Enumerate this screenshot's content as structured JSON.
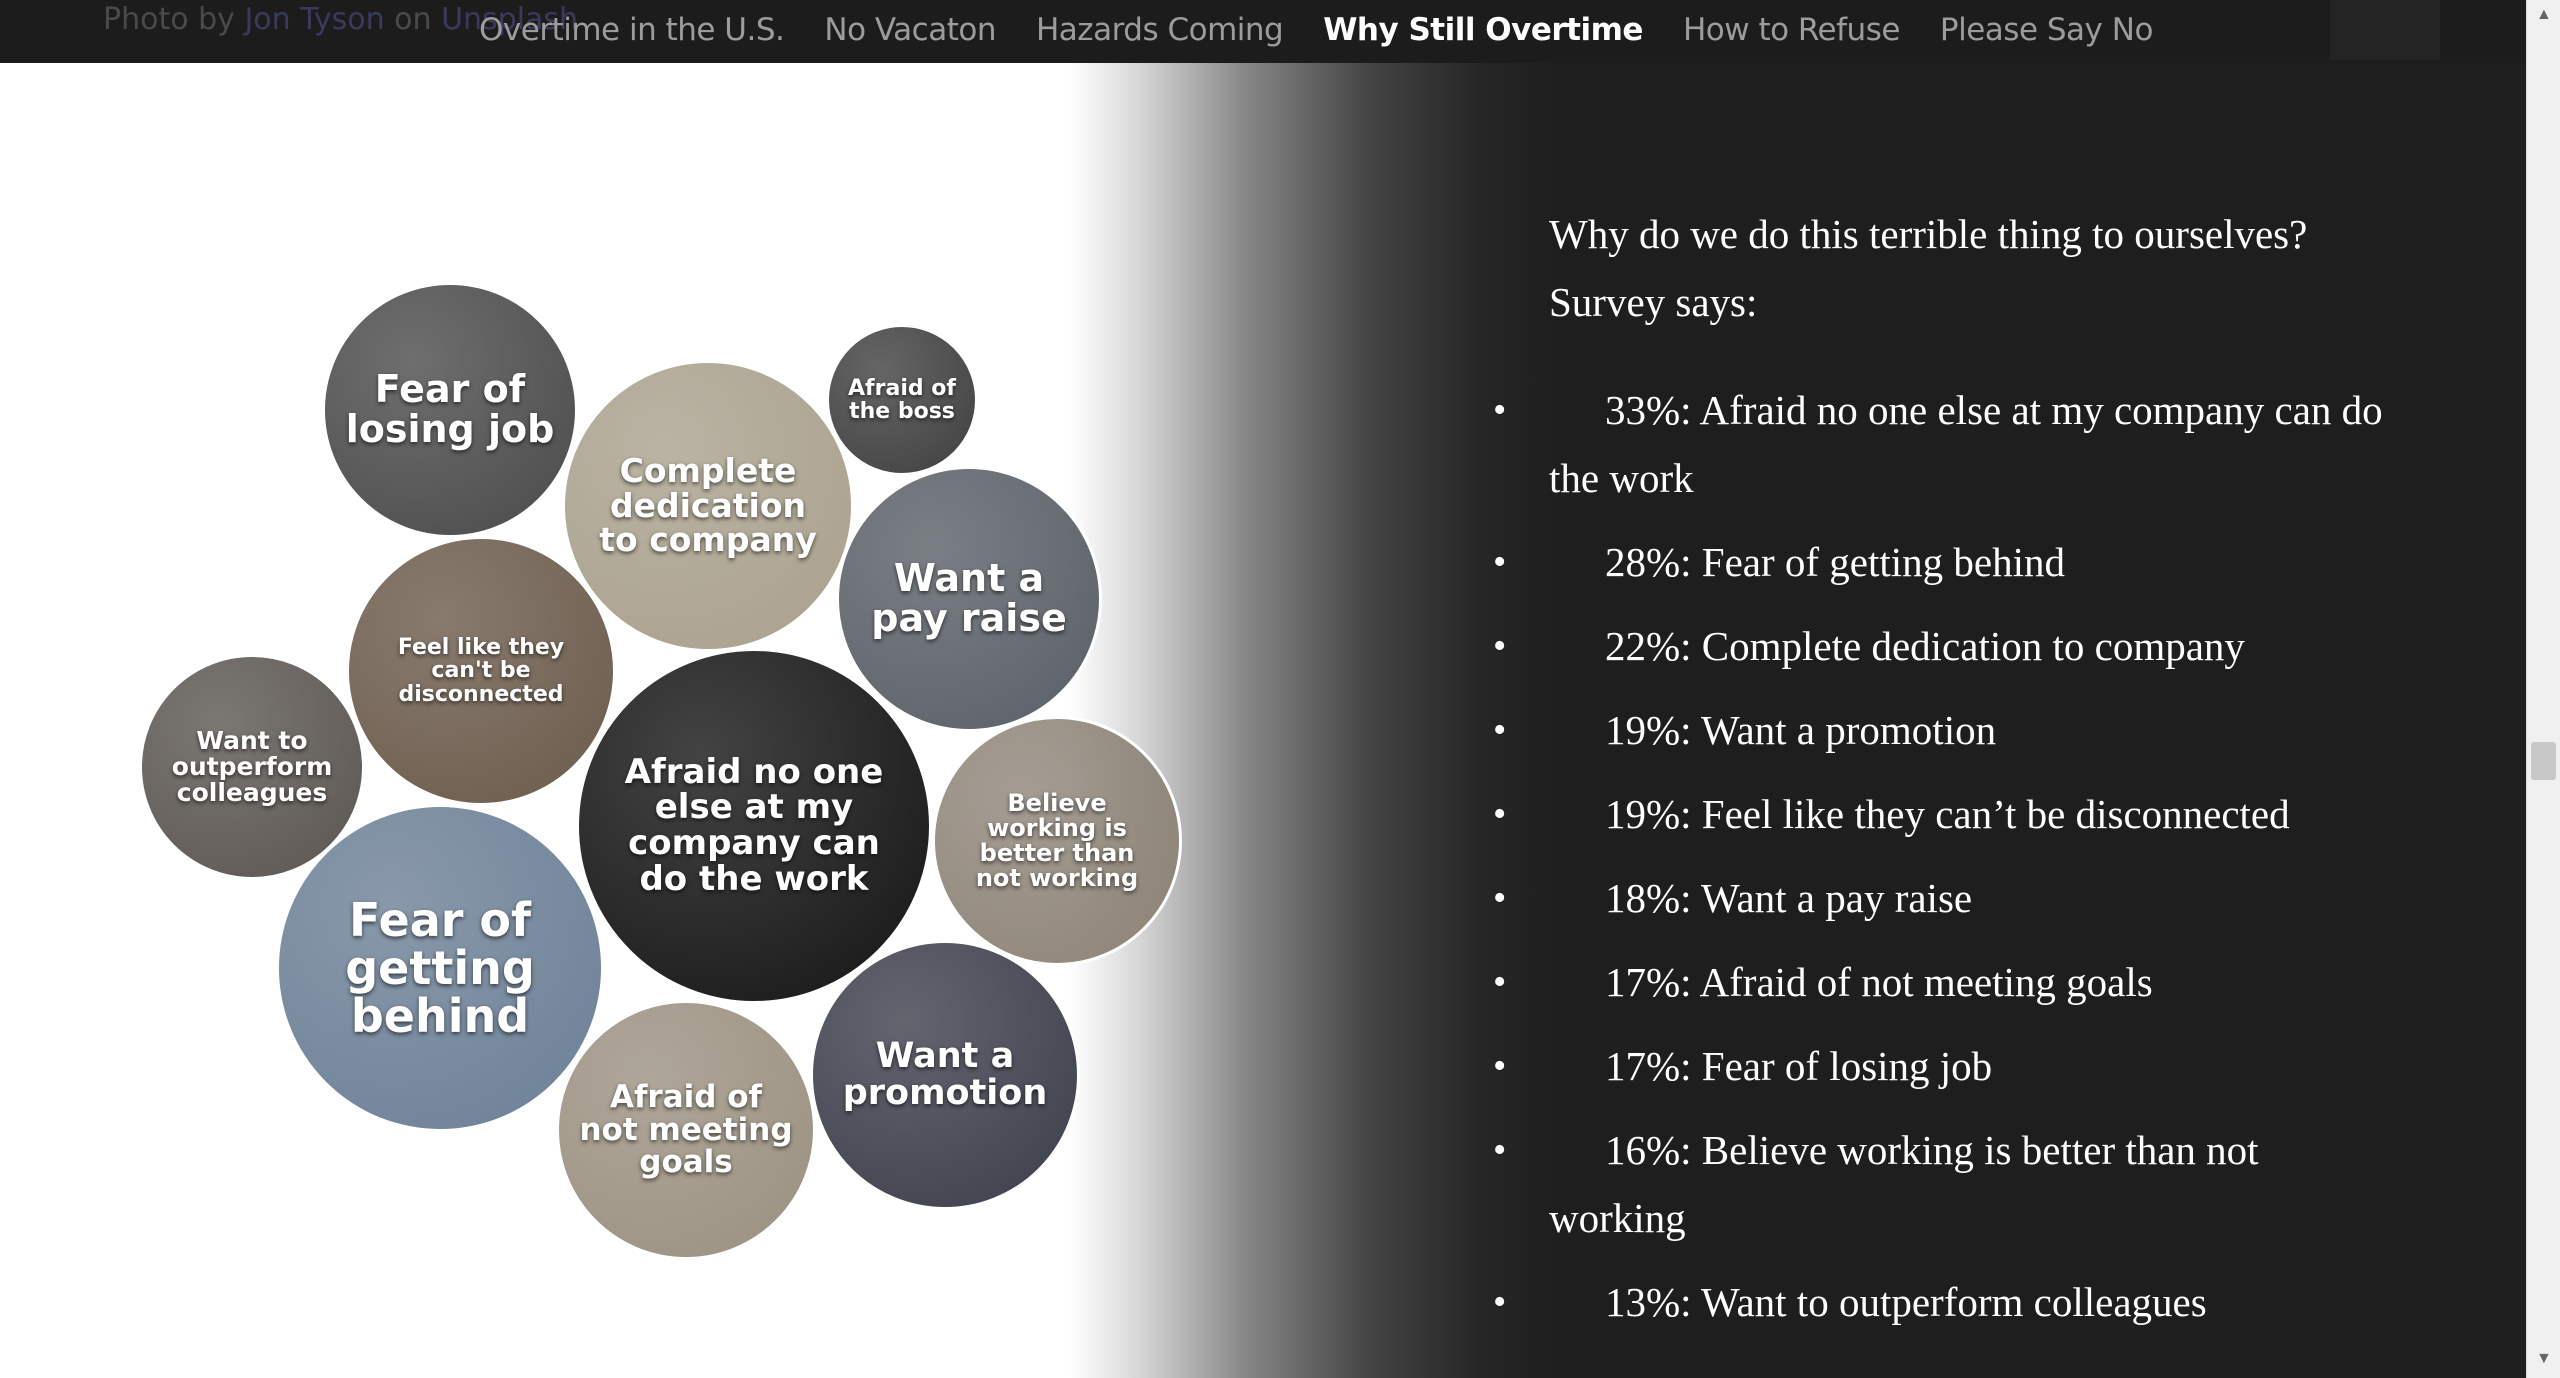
{
  "photo_credit": {
    "prefix": "Photo by ",
    "author": "Jon Tyson",
    "middle": " on ",
    "site": "Unsplash"
  },
  "nav": {
    "items": [
      {
        "label": "Overtime in the U.S.",
        "active": false
      },
      {
        "label": "No Vacaton",
        "active": false
      },
      {
        "label": "Hazards Coming",
        "active": false
      },
      {
        "label": "Why Still Overtime",
        "active": true
      },
      {
        "label": "How to Refuse",
        "active": false
      },
      {
        "label": "Please Say No",
        "active": false
      }
    ]
  },
  "bubbles": [
    {
      "label": "Fear of losing job",
      "color": "#4a4a4a"
    },
    {
      "label": "Afraid of the boss",
      "color": "#3f3f3f"
    },
    {
      "label": "Complete dedication to company",
      "color": "#a9a08c"
    },
    {
      "label": "Want a pay raise",
      "color": "#595f66"
    },
    {
      "label": "Feel like they can't be disconnected",
      "color": "#6a5a4a"
    },
    {
      "label": "Want to outperform colleagues",
      "color": "#5a5550"
    },
    {
      "label": "Afraid no one else at my company can do the work",
      "color": "#141414"
    },
    {
      "label": "Believe working is better than not working",
      "color": "#8e8478"
    },
    {
      "label": "Fear of getting behind",
      "color": "#6b7f95"
    },
    {
      "label": "Want a promotion",
      "color": "#3b3e4a"
    },
    {
      "label": "Afraid of not meeting goals",
      "color": "#9a9080"
    }
  ],
  "content": {
    "intro_question": "Why do we do this terrible thing to ourselves?",
    "intro_survey": "Survey says:",
    "survey": [
      "33%: Afraid no one else at my company can do the work",
      "28%: Fear of getting behind",
      "22%: Complete dedication to company",
      "19%: Want a promotion",
      "19%: Feel like they can’t be disconnected",
      "18%: Want a pay raise",
      "17%: Afraid of not meeting goals",
      "17%: Fear of losing job",
      "16%: Believe working is better than not working",
      "13%: Want to outperform colleagues"
    ]
  },
  "colors": {
    "nav_bg": "#1c1c1c",
    "nav_active": "#ffffff",
    "nav_inactive": "#9c9c9c",
    "dark_bg": "#1e1e1e"
  }
}
